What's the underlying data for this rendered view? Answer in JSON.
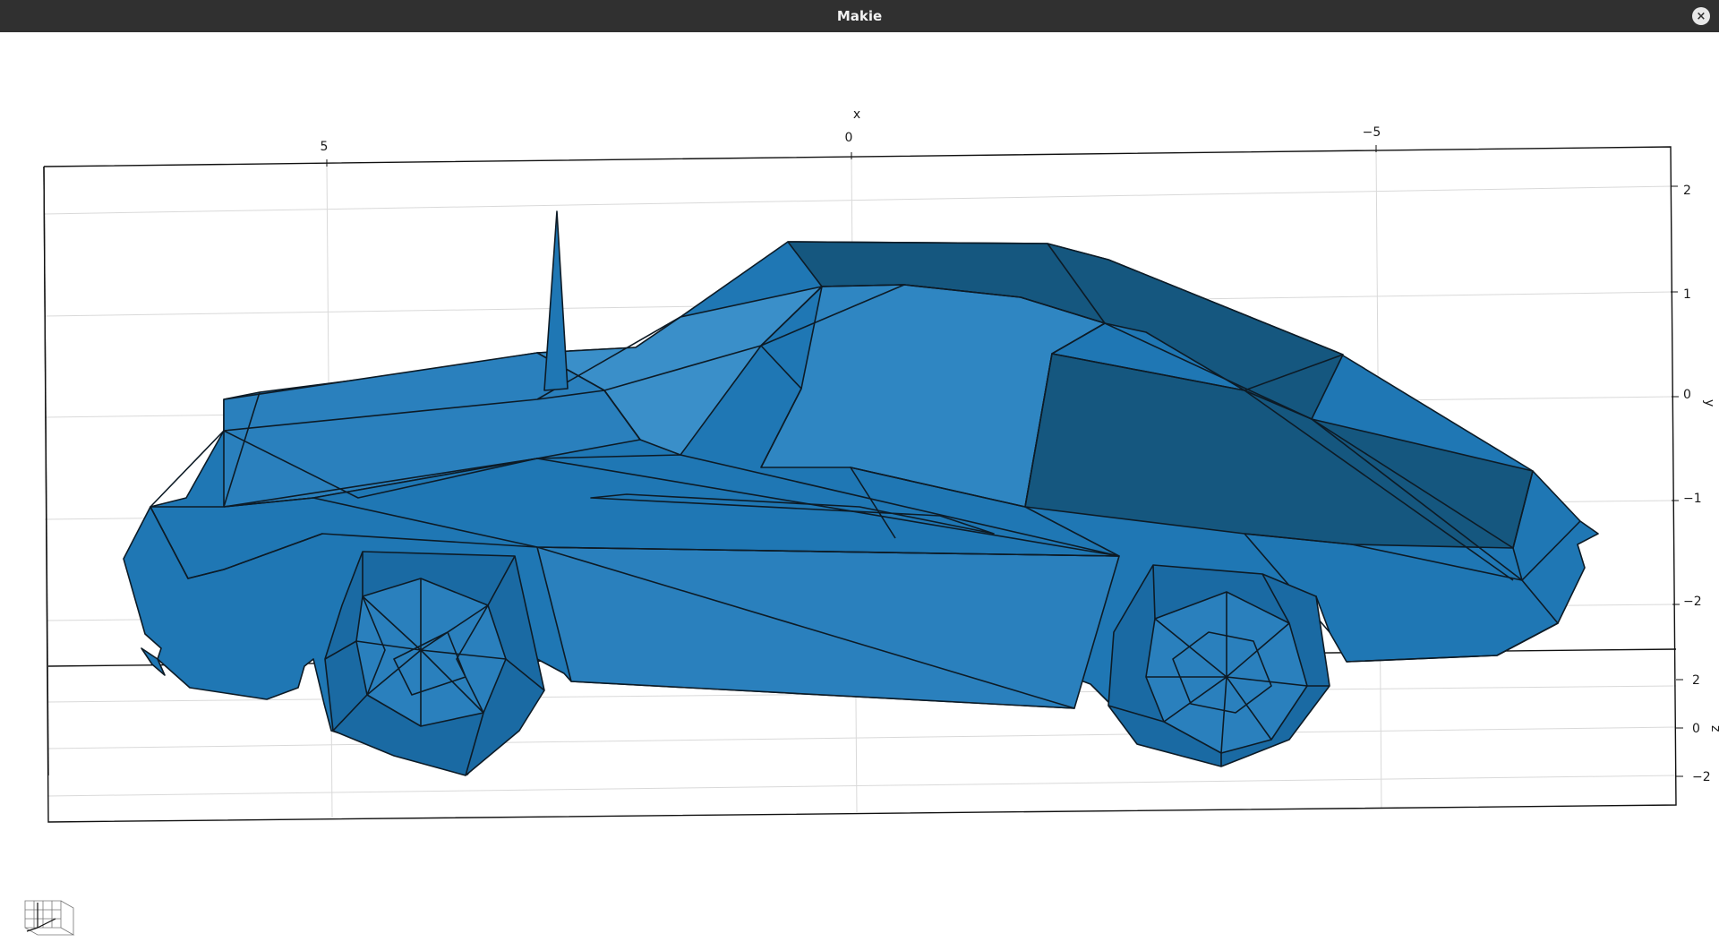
{
  "window": {
    "title": "Makie",
    "close_label": "×"
  },
  "axes": {
    "x": {
      "label": "x",
      "ticks": [
        "5",
        "0",
        "−5"
      ]
    },
    "y": {
      "label": "y",
      "ticks": [
        "2",
        "1",
        "0",
        "−1",
        "−2"
      ]
    },
    "z": {
      "label": "z",
      "ticks": [
        "2",
        "0",
        "−2"
      ]
    }
  },
  "colors": {
    "mesh": "#1f77b4",
    "mesh_dark": "#15577f",
    "mesh_light": "#3a8fc9",
    "titlebar": "#303030"
  },
  "icons": {
    "axis_gizmo": "axis-cube-icon"
  }
}
